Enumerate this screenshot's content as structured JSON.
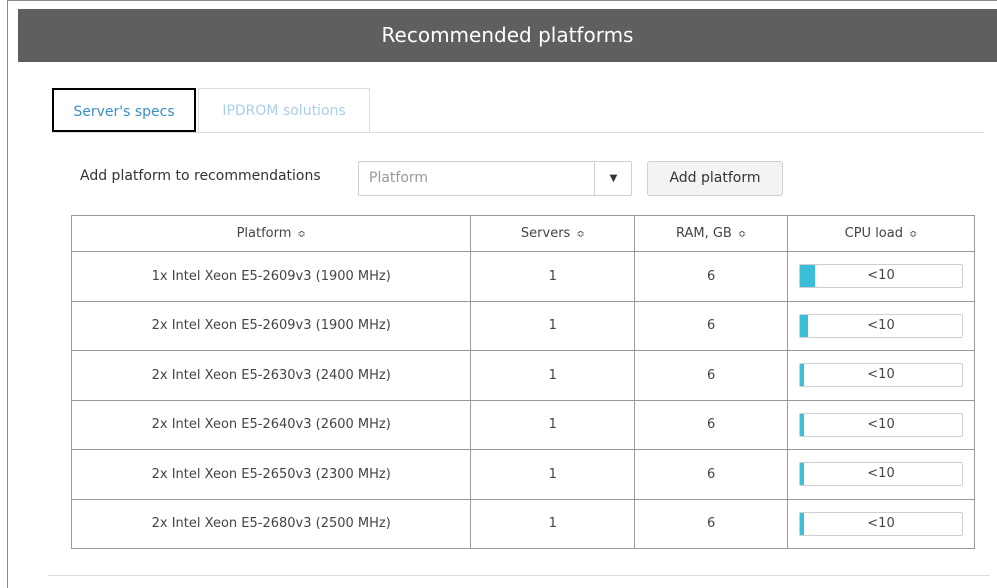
{
  "header": {
    "title": "Recommended platforms"
  },
  "tabs": [
    {
      "label": "Server's specs",
      "active": true
    },
    {
      "label": "IPDROM solutions",
      "active": false
    }
  ],
  "add_platform": {
    "label": "Add platform to recommendations",
    "select_placeholder": "Platform",
    "button_label": "Add platform"
  },
  "table": {
    "columns": [
      "Platform",
      "Servers",
      "RAM, GB",
      "CPU load"
    ],
    "rows": [
      {
        "platform": "1x Intel Xeon E5-2609v3 (1900 MHz)",
        "servers": "1",
        "ram": "6",
        "cpu": "<10",
        "cpu_fill_percent": 9
      },
      {
        "platform": "2x Intel Xeon E5-2609v3 (1900 MHz)",
        "servers": "1",
        "ram": "6",
        "cpu": "<10",
        "cpu_fill_percent": 5
      },
      {
        "platform": "2x Intel Xeon E5-2630v3 (2400 MHz)",
        "servers": "1",
        "ram": "6",
        "cpu": "<10",
        "cpu_fill_percent": 2.5
      },
      {
        "platform": "2x Intel Xeon E5-2640v3 (2600 MHz)",
        "servers": "1",
        "ram": "6",
        "cpu": "<10",
        "cpu_fill_percent": 2.5
      },
      {
        "platform": "2x Intel Xeon E5-2650v3 (2300 MHz)",
        "servers": "1",
        "ram": "6",
        "cpu": "<10",
        "cpu_fill_percent": 2.5
      },
      {
        "platform": "2x Intel Xeon E5-2680v3 (2500 MHz)",
        "servers": "1",
        "ram": "6",
        "cpu": "<10",
        "cpu_fill_percent": 2.5
      }
    ]
  },
  "colors": {
    "header_bg": "#5f5f5f",
    "active_tab_text": "#3a8fc4",
    "inactive_tab_text": "#a9cfe8",
    "cpu_fill": "#3bbfd9"
  }
}
